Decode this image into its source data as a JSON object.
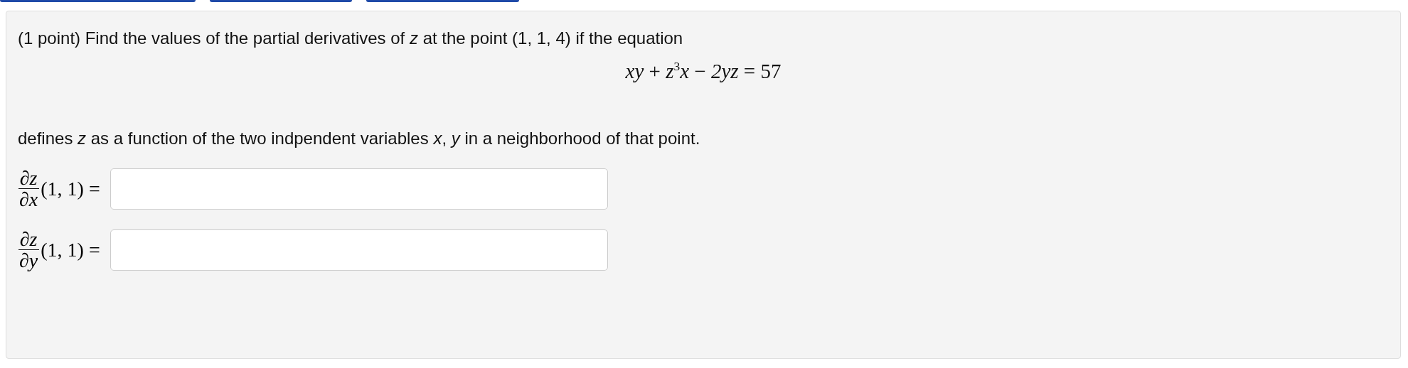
{
  "problem": {
    "intro": "(1 point) Find the values of the partial derivatives of *z* at the point (1, 1, 4) if the equation",
    "equation": "*xy* + *z*$^{3}$*x* − *2yz* = 57",
    "conclusion": "defines *z* as a function of the two indpendent variables *x*, *y* in a neighborhood of that point.",
    "answers": [
      {
        "numerator": "∂z",
        "denominator": "∂x",
        "point": "(1, 1) ="
      },
      {
        "numerator": "∂z",
        "denominator": "∂y",
        "point": "(1, 1) ="
      }
    ]
  }
}
